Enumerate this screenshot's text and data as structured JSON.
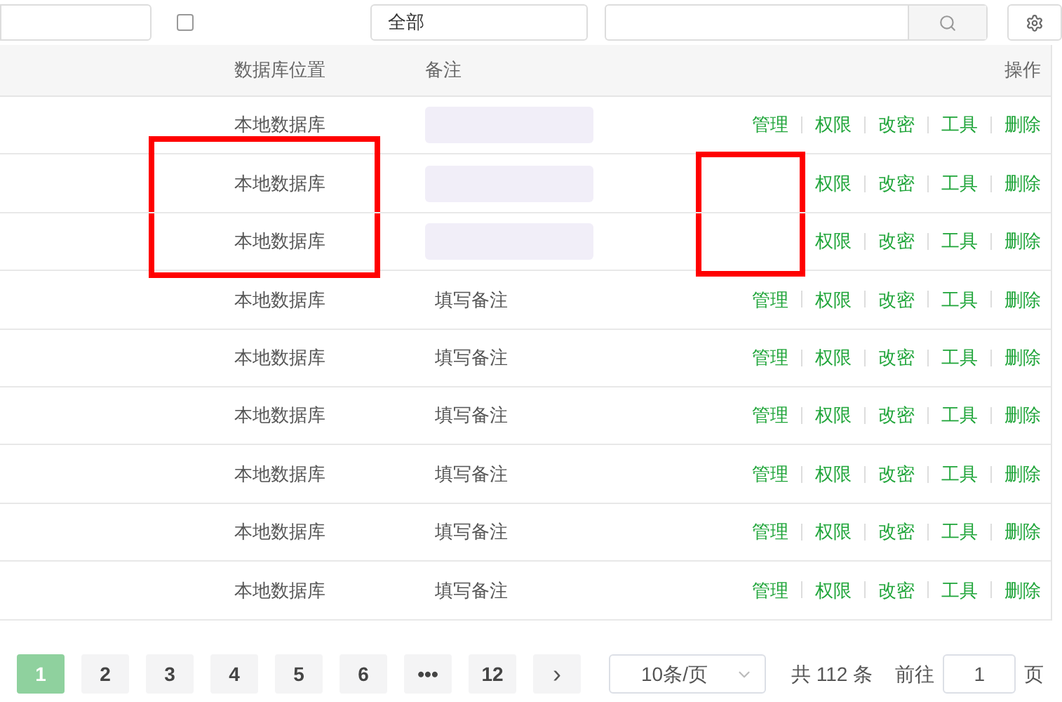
{
  "toolbar": {
    "filter_select": {
      "value": "全部"
    }
  },
  "table": {
    "columns": [
      {
        "label": "数据库位置"
      },
      {
        "label": "备注"
      },
      {
        "label": "操作"
      }
    ],
    "rows": [
      {
        "location": "本地数据库",
        "note": {
          "kind": "redacted"
        },
        "actions": [
          "管理",
          "权限",
          "改密",
          "工具",
          "删除"
        ],
        "marked": false
      },
      {
        "location": "本地数据库",
        "note": {
          "kind": "redacted"
        },
        "actions": [
          "权限",
          "改密",
          "工具",
          "删除"
        ],
        "marked": true
      },
      {
        "location": "本地数据库",
        "note": {
          "kind": "redacted"
        },
        "actions": [
          "权限",
          "改密",
          "工具",
          "删除"
        ],
        "marked": true
      },
      {
        "location": "本地数据库",
        "note": {
          "kind": "text",
          "text": "填写备注"
        },
        "actions": [
          "管理",
          "权限",
          "改密",
          "工具",
          "删除"
        ],
        "marked": false
      },
      {
        "location": "本地数据库",
        "note": {
          "kind": "text",
          "text": "填写备注"
        },
        "actions": [
          "管理",
          "权限",
          "改密",
          "工具",
          "删除"
        ],
        "marked": false
      },
      {
        "location": "本地数据库",
        "note": {
          "kind": "text",
          "text": "填写备注"
        },
        "actions": [
          "管理",
          "权限",
          "改密",
          "工具",
          "删除"
        ],
        "marked": false
      },
      {
        "location": "本地数据库",
        "note": {
          "kind": "text",
          "text": "填写备注"
        },
        "actions": [
          "管理",
          "权限",
          "改密",
          "工具",
          "删除"
        ],
        "marked": false
      },
      {
        "location": "本地数据库",
        "note": {
          "kind": "text",
          "text": "填写备注"
        },
        "actions": [
          "管理",
          "权限",
          "改密",
          "工具",
          "删除"
        ],
        "marked": false
      },
      {
        "location": "本地数据库",
        "note": {
          "kind": "text",
          "text": "填写备注"
        },
        "actions": [
          "管理",
          "权限",
          "改密",
          "工具",
          "删除"
        ],
        "marked": false
      }
    ]
  },
  "pagination": {
    "pages": [
      {
        "label": "1",
        "selected": true
      },
      {
        "label": "2",
        "selected": false
      },
      {
        "label": "3",
        "selected": false
      },
      {
        "label": "4",
        "selected": false
      },
      {
        "label": "5",
        "selected": false
      },
      {
        "label": "6",
        "selected": false
      },
      {
        "label": "•••",
        "selected": false
      },
      {
        "label": "12",
        "selected": false
      }
    ],
    "next": "›",
    "page_size": "10条/页",
    "total": "共 112 条",
    "goto_label": "前往",
    "goto_value": "1",
    "page_unit": "页"
  }
}
